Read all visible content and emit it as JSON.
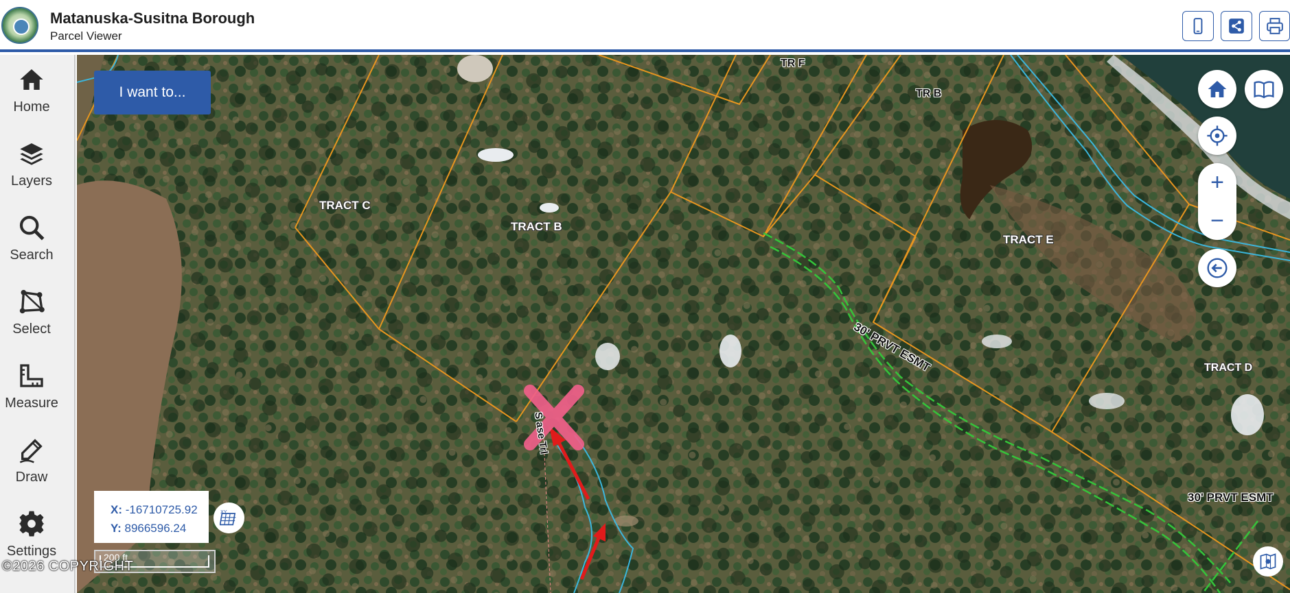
{
  "header": {
    "title": "Matanuska-Susitna Borough",
    "subtitle": "Parcel Viewer",
    "accent_color": "#2e5ba8",
    "buttons": [
      {
        "name": "mobile-view",
        "icon": "mobile-phone-icon"
      },
      {
        "name": "share",
        "icon": "share-icon"
      },
      {
        "name": "print",
        "icon": "printer-icon"
      }
    ]
  },
  "sidebar": {
    "items": [
      {
        "label": "Home",
        "icon": "home-icon"
      },
      {
        "label": "Layers",
        "icon": "layers-icon"
      },
      {
        "label": "Search",
        "icon": "search-icon"
      },
      {
        "label": "Select",
        "icon": "select-polygon-icon"
      },
      {
        "label": "Measure",
        "icon": "ruler-icon"
      },
      {
        "label": "Draw",
        "icon": "pencil-icon"
      },
      {
        "label": "Settings",
        "icon": "gear-icon"
      }
    ]
  },
  "map": {
    "i_want_to_label": "I want to...",
    "controls": [
      "home-icon",
      "bookmarks-book-icon",
      "locate-crosshair-icon",
      "zoom-in-icon",
      "zoom-out-icon",
      "back-arrow-icon"
    ],
    "zoom_in_label": "+",
    "zoom_out_label": "−",
    "coordinates": {
      "x_label": "X:",
      "x_value": "-16710725.92",
      "y_label": "Y:",
      "y_value": "8966596.24"
    },
    "scale_label": "200 ft",
    "copyright": "©2026 COPYRIGHT",
    "parcel_labels": {
      "tr_f": "TR F",
      "tr_b": "TR B",
      "tract_c": "TRACT C",
      "tract_b": "TRACT B",
      "tract_e": "TRACT E",
      "tract_d": "TRACT D",
      "esmt_1": "30' PRVT ESMT",
      "esmt_2": "30' PRVT ESMT",
      "trail": "S    ase Trl"
    },
    "colors": {
      "parcel_line": "#e8951f",
      "easement_line": "#35c43a",
      "road_line": "#3bb6dd",
      "marker": "#f0608a",
      "arrow": "#e01b1b"
    }
  }
}
